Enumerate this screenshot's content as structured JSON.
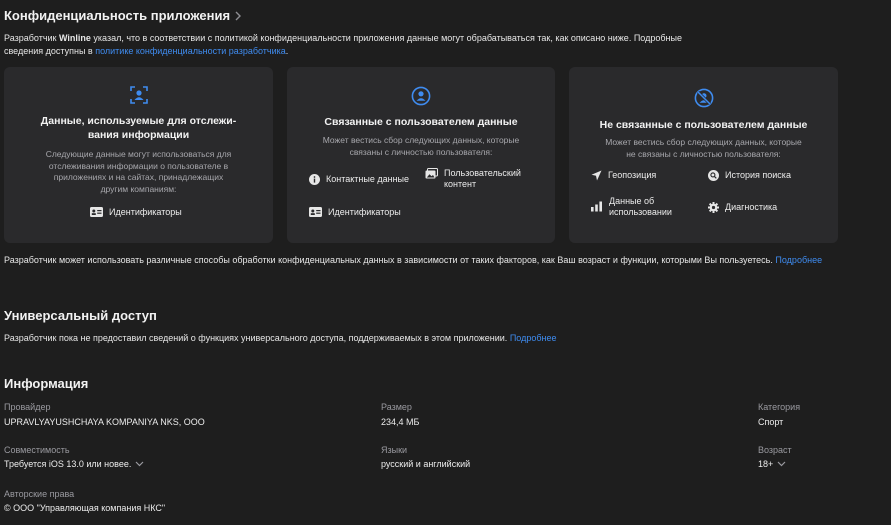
{
  "privacy": {
    "title": "Конфиденциальность приложения",
    "intro_pre": "Разработчик ",
    "developer": "Winline",
    "intro_mid": " указал, что в соответствии с политикой конфиденциальности приложения данные могут обрабатываться так, как описано ниже. Подробные",
    "intro_line2_pre": "сведения доступны в ",
    "policy_link": "политике конфиденциальности разработчика",
    "intro_line2_post": ".",
    "cards": {
      "tracking": {
        "title_l1": "Данные, используемые для отслежи-",
        "title_l2": "вания информации",
        "desc_l1": "Следующие данные могут использоваться для",
        "desc_l2": "отслеживания информации о пользователе в",
        "desc_l3": "приложениях и на сайтах, принадлежащих",
        "desc_l4": "другим компаниям:",
        "items": [
          "Идентификаторы"
        ]
      },
      "linked": {
        "title": "Связанные с пользователем данные",
        "desc_l1": "Может вестись сбор следующих данных, которые",
        "desc_l2": "связаны с личностью пользователя:",
        "items": [
          "Контактные данные",
          "Пользовательский",
          "контент",
          "Идентификаторы"
        ]
      },
      "not_linked": {
        "title": "Не связанные с пользователем данные",
        "desc_l1": "Может вестись сбор следующих данных, которые",
        "desc_l2": "не связаны с личностью пользователя:",
        "items": [
          "Геопозиция",
          "История поиска",
          "Данные об",
          "использовании",
          "Диагностика"
        ]
      }
    },
    "footnote": "Разработчик может использовать различные способы обработки конфиденциальных данных в зависимости от таких факторов, как Ваш возраст и функции, которыми Вы пользуетесь.",
    "footnote_link": "Подробнее"
  },
  "accessibility": {
    "title": "Универсальный доступ",
    "text": "Разработчик пока не предоставил сведений о функциях универсального доступа, поддерживаемых в этом приложении.",
    "link": "Подробнее"
  },
  "info": {
    "title": "Информация",
    "provider_label": "Провайдер",
    "provider": "UPRAVLYAYUSHCHAYA KOMPANIYA NKS, OOO",
    "size_label": "Размер",
    "size": "234,4 МБ",
    "category_label": "Категория",
    "category": "Спорт",
    "compat_label": "Совместимость",
    "compat": "Требуется iOS 13.0 или новее.",
    "languages_label": "Языки",
    "languages": "русский и английский",
    "age_label": "Возраст",
    "age": "18+",
    "copyright_label": "Авторские права",
    "copyright": "© ООО \"Управляющая компания НКС\""
  },
  "colors": {
    "background": "#1e1e1e",
    "card": "#2a2a2c",
    "accent": "#3f8cf0"
  }
}
